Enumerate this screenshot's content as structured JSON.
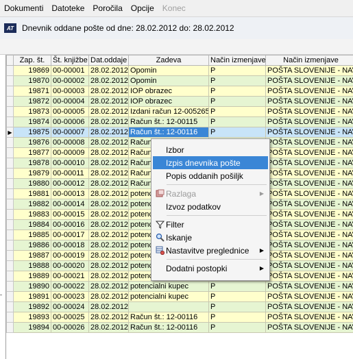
{
  "menu": [
    "Dokumenti",
    "Datoteke",
    "Poročila",
    "Opcije",
    "Konec"
  ],
  "title": "Dnevnik oddane pošte od dne: 28.02.2012 do: 28.02.2012",
  "logo_text": "AT",
  "columns": [
    "Zap. št.",
    "Št. knjižbe",
    "Dat.oddaje",
    "Zadeva",
    "Način izmenjave",
    "Način izmenjave"
  ],
  "rows": [
    {
      "zap": "19869",
      "kn": "00-00001",
      "dat": "28.02.2012",
      "zad": "Opomin",
      "n1": "P",
      "n2": "POŠTA SLOVENIJE - NAVADNA"
    },
    {
      "zap": "19870",
      "kn": "00-00002",
      "dat": "28.02.2012",
      "zad": "Opomin",
      "n1": "P",
      "n2": "POŠTA SLOVENIJE - NAVADNA"
    },
    {
      "zap": "19871",
      "kn": "00-00003",
      "dat": "28.02.2012",
      "zad": "IOP obrazec",
      "n1": "P",
      "n2": "POŠTA SLOVENIJE - NAVADNA"
    },
    {
      "zap": "19872",
      "kn": "00-00004",
      "dat": "28.02.2012",
      "zad": "IOP obrazec",
      "n1": "P",
      "n2": "POŠTA SLOVENIJE - NAVADNA"
    },
    {
      "zap": "19873",
      "kn": "00-00005",
      "dat": "28.02.2012",
      "zad": "Izdani račun 12-005265",
      "n1": "P",
      "n2": "POŠTA SLOVENIJE - NAVADNA"
    },
    {
      "zap": "19874",
      "kn": "00-00006",
      "dat": "28.02.2012",
      "zad": "Račun št.: 12-00115",
      "n1": "P",
      "n2": "POŠTA SLOVENIJE - NAVADNA"
    },
    {
      "zap": "19875",
      "kn": "00-00007",
      "dat": "28.02.2012",
      "zad": "Račun št.: 12-00116",
      "n1": "P",
      "n2": "POŠTA SLOVENIJE - NAVADNA"
    },
    {
      "zap": "19876",
      "kn": "00-00008",
      "dat": "28.02.2012",
      "zad": "Račun :",
      "n1": "P",
      "n2": "POŠTA SLOVENIJE - NAVADNA"
    },
    {
      "zap": "19877",
      "kn": "00-00009",
      "dat": "28.02.2012",
      "zad": "Račun :",
      "n1": "P",
      "n2": "POŠTA SLOVENIJE - NAVADNA"
    },
    {
      "zap": "19878",
      "kn": "00-00010",
      "dat": "28.02.2012",
      "zad": "Račun :",
      "n1": "P",
      "n2": "POŠTA SLOVENIJE - NAVADNA"
    },
    {
      "zap": "19879",
      "kn": "00-00011",
      "dat": "28.02.2012",
      "zad": "Račun :",
      "n1": "P",
      "n2": "POŠTA SLOVENIJE - NAVADNA"
    },
    {
      "zap": "19880",
      "kn": "00-00012",
      "dat": "28.02.2012",
      "zad": "Račun :",
      "n1": "P",
      "n2": "POŠTA SLOVENIJE - NAVADNA"
    },
    {
      "zap": "19881",
      "kn": "00-00013",
      "dat": "28.02.2012",
      "zad": "potenciaI",
      "n1": "P",
      "n2": "POŠTA SLOVENIJE - NAVADNA"
    },
    {
      "zap": "19882",
      "kn": "00-00014",
      "dat": "28.02.2012",
      "zad": "potenciaI",
      "n1": "P",
      "n2": "POŠTA SLOVENIJE - NAVADNA"
    },
    {
      "zap": "19883",
      "kn": "00-00015",
      "dat": "28.02.2012",
      "zad": "potenciaI",
      "n1": "P",
      "n2": "POŠTA SLOVENIJE - NAVADNA"
    },
    {
      "zap": "19884",
      "kn": "00-00016",
      "dat": "28.02.2012",
      "zad": "potenciaI",
      "n1": "P",
      "n2": "POŠTA SLOVENIJE - NAVADNA"
    },
    {
      "zap": "19885",
      "kn": "00-00017",
      "dat": "28.02.2012",
      "zad": "potenciaI",
      "n1": "P",
      "n2": "POŠTA SLOVENIJE - NAVADNA"
    },
    {
      "zap": "19886",
      "kn": "00-00018",
      "dat": "28.02.2012",
      "zad": "potenciaI",
      "n1": "P",
      "n2": "POŠTA SLOVENIJE - NAVADNA"
    },
    {
      "zap": "19887",
      "kn": "00-00019",
      "dat": "28.02.2012",
      "zad": "potenciaI",
      "n1": "P",
      "n2": "POŠTA SLOVENIJE - NAVADNA"
    },
    {
      "zap": "19888",
      "kn": "00-00020",
      "dat": "28.02.2012",
      "zad": "potenciaI",
      "n1": "P",
      "n2": "POŠTA SLOVENIJE - NAVADNA"
    },
    {
      "zap": "19889",
      "kn": "00-00021",
      "dat": "28.02.2012",
      "zad": "potencialni kupec",
      "n1": "P",
      "n2": "POŠTA SLOVENIJE - NAVADNA"
    },
    {
      "zap": "19890",
      "kn": "00-00022",
      "dat": "28.02.2012",
      "zad": "potencialni kupec",
      "n1": "P",
      "n2": "POŠTA SLOVENIJE - NAVADNA"
    },
    {
      "zap": "19891",
      "kn": "00-00023",
      "dat": "28.02.2012",
      "zad": "potencialni kupec",
      "n1": "P",
      "n2": "POŠTA SLOVENIJE - NAVADNA"
    },
    {
      "zap": "19892",
      "kn": "00-00024",
      "dat": "28.02.2012",
      "zad": "",
      "n1": "P",
      "n2": "POŠTA SLOVENIJE - NAVADNA"
    },
    {
      "zap": "19893",
      "kn": "00-00025",
      "dat": "28.02.2012",
      "zad": "Račun št.: 12-00116",
      "n1": "P",
      "n2": "POŠTA SLOVENIJE - NAVADNA"
    },
    {
      "zap": "19894",
      "kn": "00-00026",
      "dat": "28.02.2012",
      "zad": "Račun št.: 12-00116",
      "n1": "P",
      "n2": "POŠTA SLOVENIJE - NAVADNA"
    }
  ],
  "selected_zap": "19875",
  "context_menu": {
    "izbor": "Izbor",
    "izpis": "Izpis dnevnika pošte",
    "popis": "Popis oddanih pošiljk",
    "razlaga": "Razlaga",
    "izvoz": "Izvoz podatkov",
    "filter": "Filter",
    "iskanje": "Iskanje",
    "nastavitve": "Nastavitve preglednice",
    "dodatni": "Dodatni postopki"
  }
}
